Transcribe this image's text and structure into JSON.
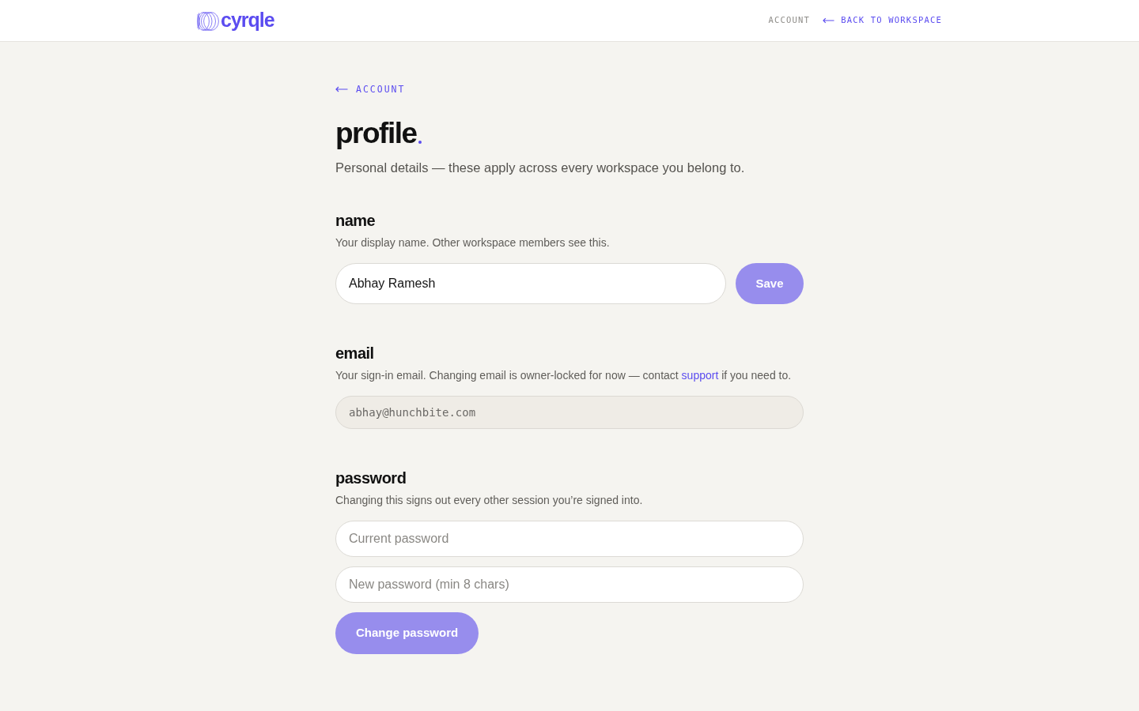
{
  "header": {
    "logo": "cyrqle",
    "nav": [
      {
        "label": "ACCOUNT",
        "kind": "plain"
      },
      {
        "label": "BACK TO WORKSPACE",
        "kind": "back"
      }
    ]
  },
  "back_link": {
    "label": "ACCOUNT"
  },
  "page": {
    "title": "profile",
    "subtitle": "Personal details — these apply across every workspace you belong to."
  },
  "sections": [
    {
      "kind": "inline",
      "heading": "name",
      "description": [
        {
          "text": "Your display name. Other workspace members see this.",
          "kind": "text"
        }
      ],
      "fields": [
        {
          "kind": "text",
          "value": "Abhay Ramesh",
          "disabled": false
        }
      ],
      "button": {
        "label": "Save",
        "disabled": true
      }
    },
    {
      "kind": "stacked",
      "heading": "email",
      "description": [
        {
          "text": "Your sign-in email. Changing email is owner-locked for now — contact ",
          "kind": "text"
        },
        {
          "text": "support",
          "kind": "link"
        },
        {
          "text": " if you need to.",
          "kind": "text"
        }
      ],
      "fields": [
        {
          "kind": "email",
          "value": "abhay@hunchbite.com",
          "disabled": true
        }
      ]
    },
    {
      "kind": "stacked",
      "heading": "password",
      "description": [
        {
          "text": "Changing this signs out every other session you’re signed into.",
          "kind": "text"
        }
      ],
      "fields": [
        {
          "kind": "password",
          "placeholder": "Current password",
          "disabled": false
        },
        {
          "kind": "password",
          "placeholder": "New password (min 8 chars)",
          "disabled": false
        }
      ],
      "button": {
        "label": "Change password",
        "disabled": true
      }
    }
  ]
}
